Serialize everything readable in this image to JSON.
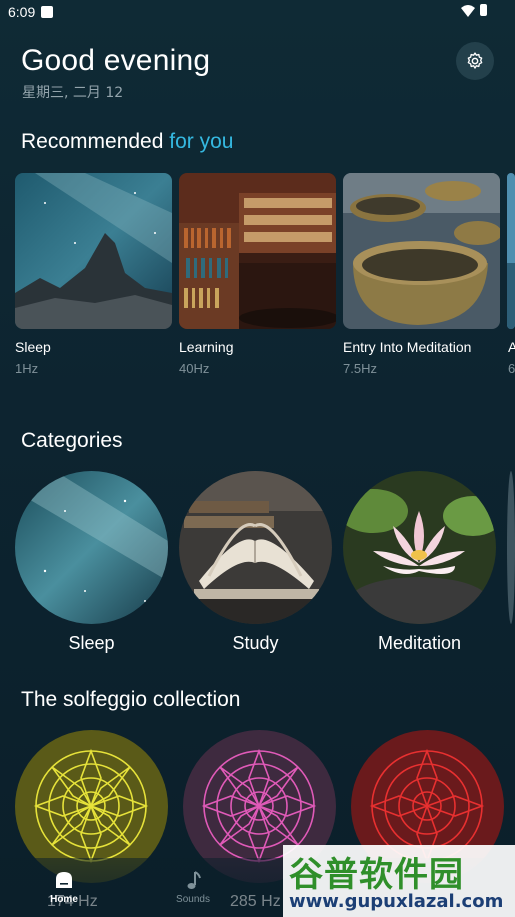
{
  "status": {
    "time": "6:09"
  },
  "header": {
    "greeting": "Good evening",
    "date": "星期三, 二月 12"
  },
  "recommended": {
    "title_main": "Recommended",
    "title_accent": "for you",
    "items": [
      {
        "title": "Sleep",
        "freq": "1Hz"
      },
      {
        "title": "Learning",
        "freq": "40Hz"
      },
      {
        "title": "Entry Into Meditation",
        "freq": "7.5Hz"
      },
      {
        "title": "A",
        "freq": "6"
      }
    ]
  },
  "categories": {
    "title": "Categories",
    "items": [
      {
        "label": "Sleep"
      },
      {
        "label": "Study"
      },
      {
        "label": "Meditation"
      }
    ]
  },
  "solfeggio": {
    "title": "The solfeggio collection",
    "items": [
      {
        "label": "174 Hz"
      },
      {
        "label": "285 Hz"
      }
    ]
  },
  "nav": {
    "items": [
      {
        "label": "Home"
      },
      {
        "label": "Sounds"
      }
    ]
  },
  "watermark": {
    "cn": "谷普软件园",
    "url": "www.gupuxlazal.com"
  },
  "colors": {
    "accent": "#35b8e0",
    "background": "#0d2430"
  }
}
